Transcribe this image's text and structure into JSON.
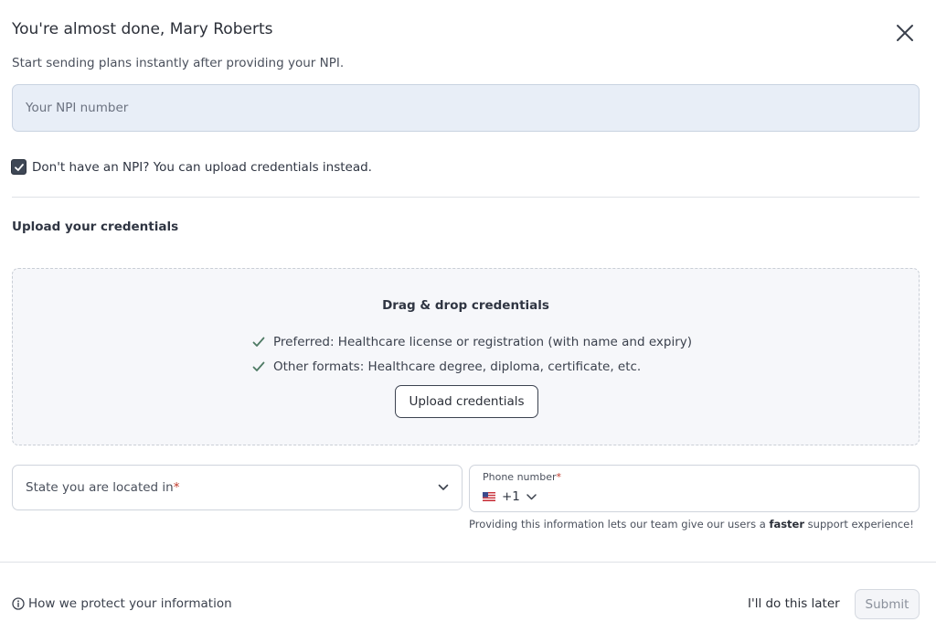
{
  "header": {
    "title": "You're almost done, Mary Roberts",
    "subtitle": "Start sending plans instantly after providing your NPI.",
    "close_icon": "close-icon"
  },
  "npi": {
    "placeholder": "Your NPI number",
    "value": ""
  },
  "no_npi": {
    "checked": true,
    "label": "Don't have an NPI? You can upload credentials instead."
  },
  "credentials": {
    "section_title": "Upload your credentials",
    "dropzone_title": "Drag & drop credentials",
    "items": [
      {
        "icon": "check-icon",
        "text": "Preferred: Healthcare license or registration (with name and expiry)"
      },
      {
        "icon": "check-icon",
        "text": "Other formats: Healthcare degree, diploma, certificate, etc."
      }
    ],
    "upload_button": "Upload credentials"
  },
  "state": {
    "label": "State you are located in",
    "required_mark": "*",
    "icon": "chevron-down-icon"
  },
  "phone": {
    "label": "Phone number",
    "required_mark": "*",
    "country_flag": "us-flag-icon",
    "country_code": "+1",
    "value": ""
  },
  "helper": {
    "before": "Providing this information lets our team give our users a ",
    "bold": "faster",
    "after": " support experience!"
  },
  "footer": {
    "protect_link": "How we protect your information",
    "protect_icon": "info-icon",
    "later_button": "I'll do this later",
    "submit_button": "Submit"
  },
  "colors": {
    "input_bg": "#e8eef7",
    "checkbox": "#3e4755",
    "check_green": "#4e7a64",
    "required": "#c0392b"
  }
}
